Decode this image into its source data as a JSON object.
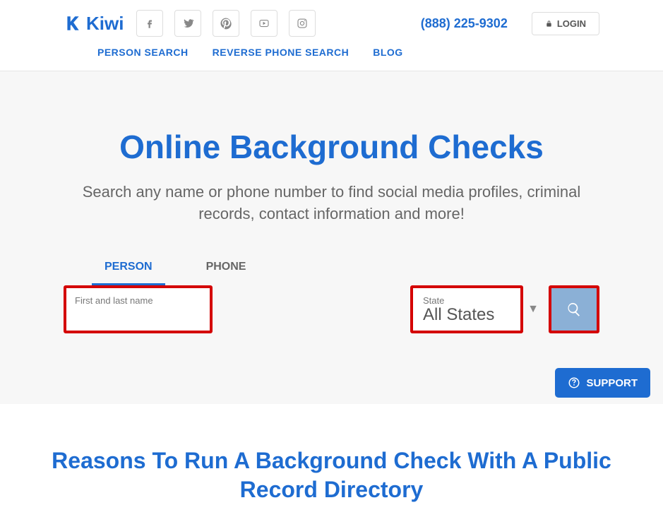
{
  "brand": {
    "name": "Kiwi"
  },
  "header": {
    "phone": "(888) 225-9302",
    "login": "LOGIN"
  },
  "nav": {
    "items": [
      "PERSON SEARCH",
      "REVERSE PHONE SEARCH",
      "BLOG"
    ]
  },
  "hero": {
    "title": "Online Background Checks",
    "subtitle": "Search any name or phone number to find social media profiles, criminal records, contact information and more!"
  },
  "tabs": {
    "person": "PERSON",
    "phone": "PHONE"
  },
  "search": {
    "name_label": "First and last name",
    "name_value": "",
    "state_label": "State",
    "state_value": "All States"
  },
  "section": {
    "reasons_title": "Reasons To Run A Background Check With A Public Record Directory"
  },
  "support": {
    "label": "SUPPORT"
  }
}
